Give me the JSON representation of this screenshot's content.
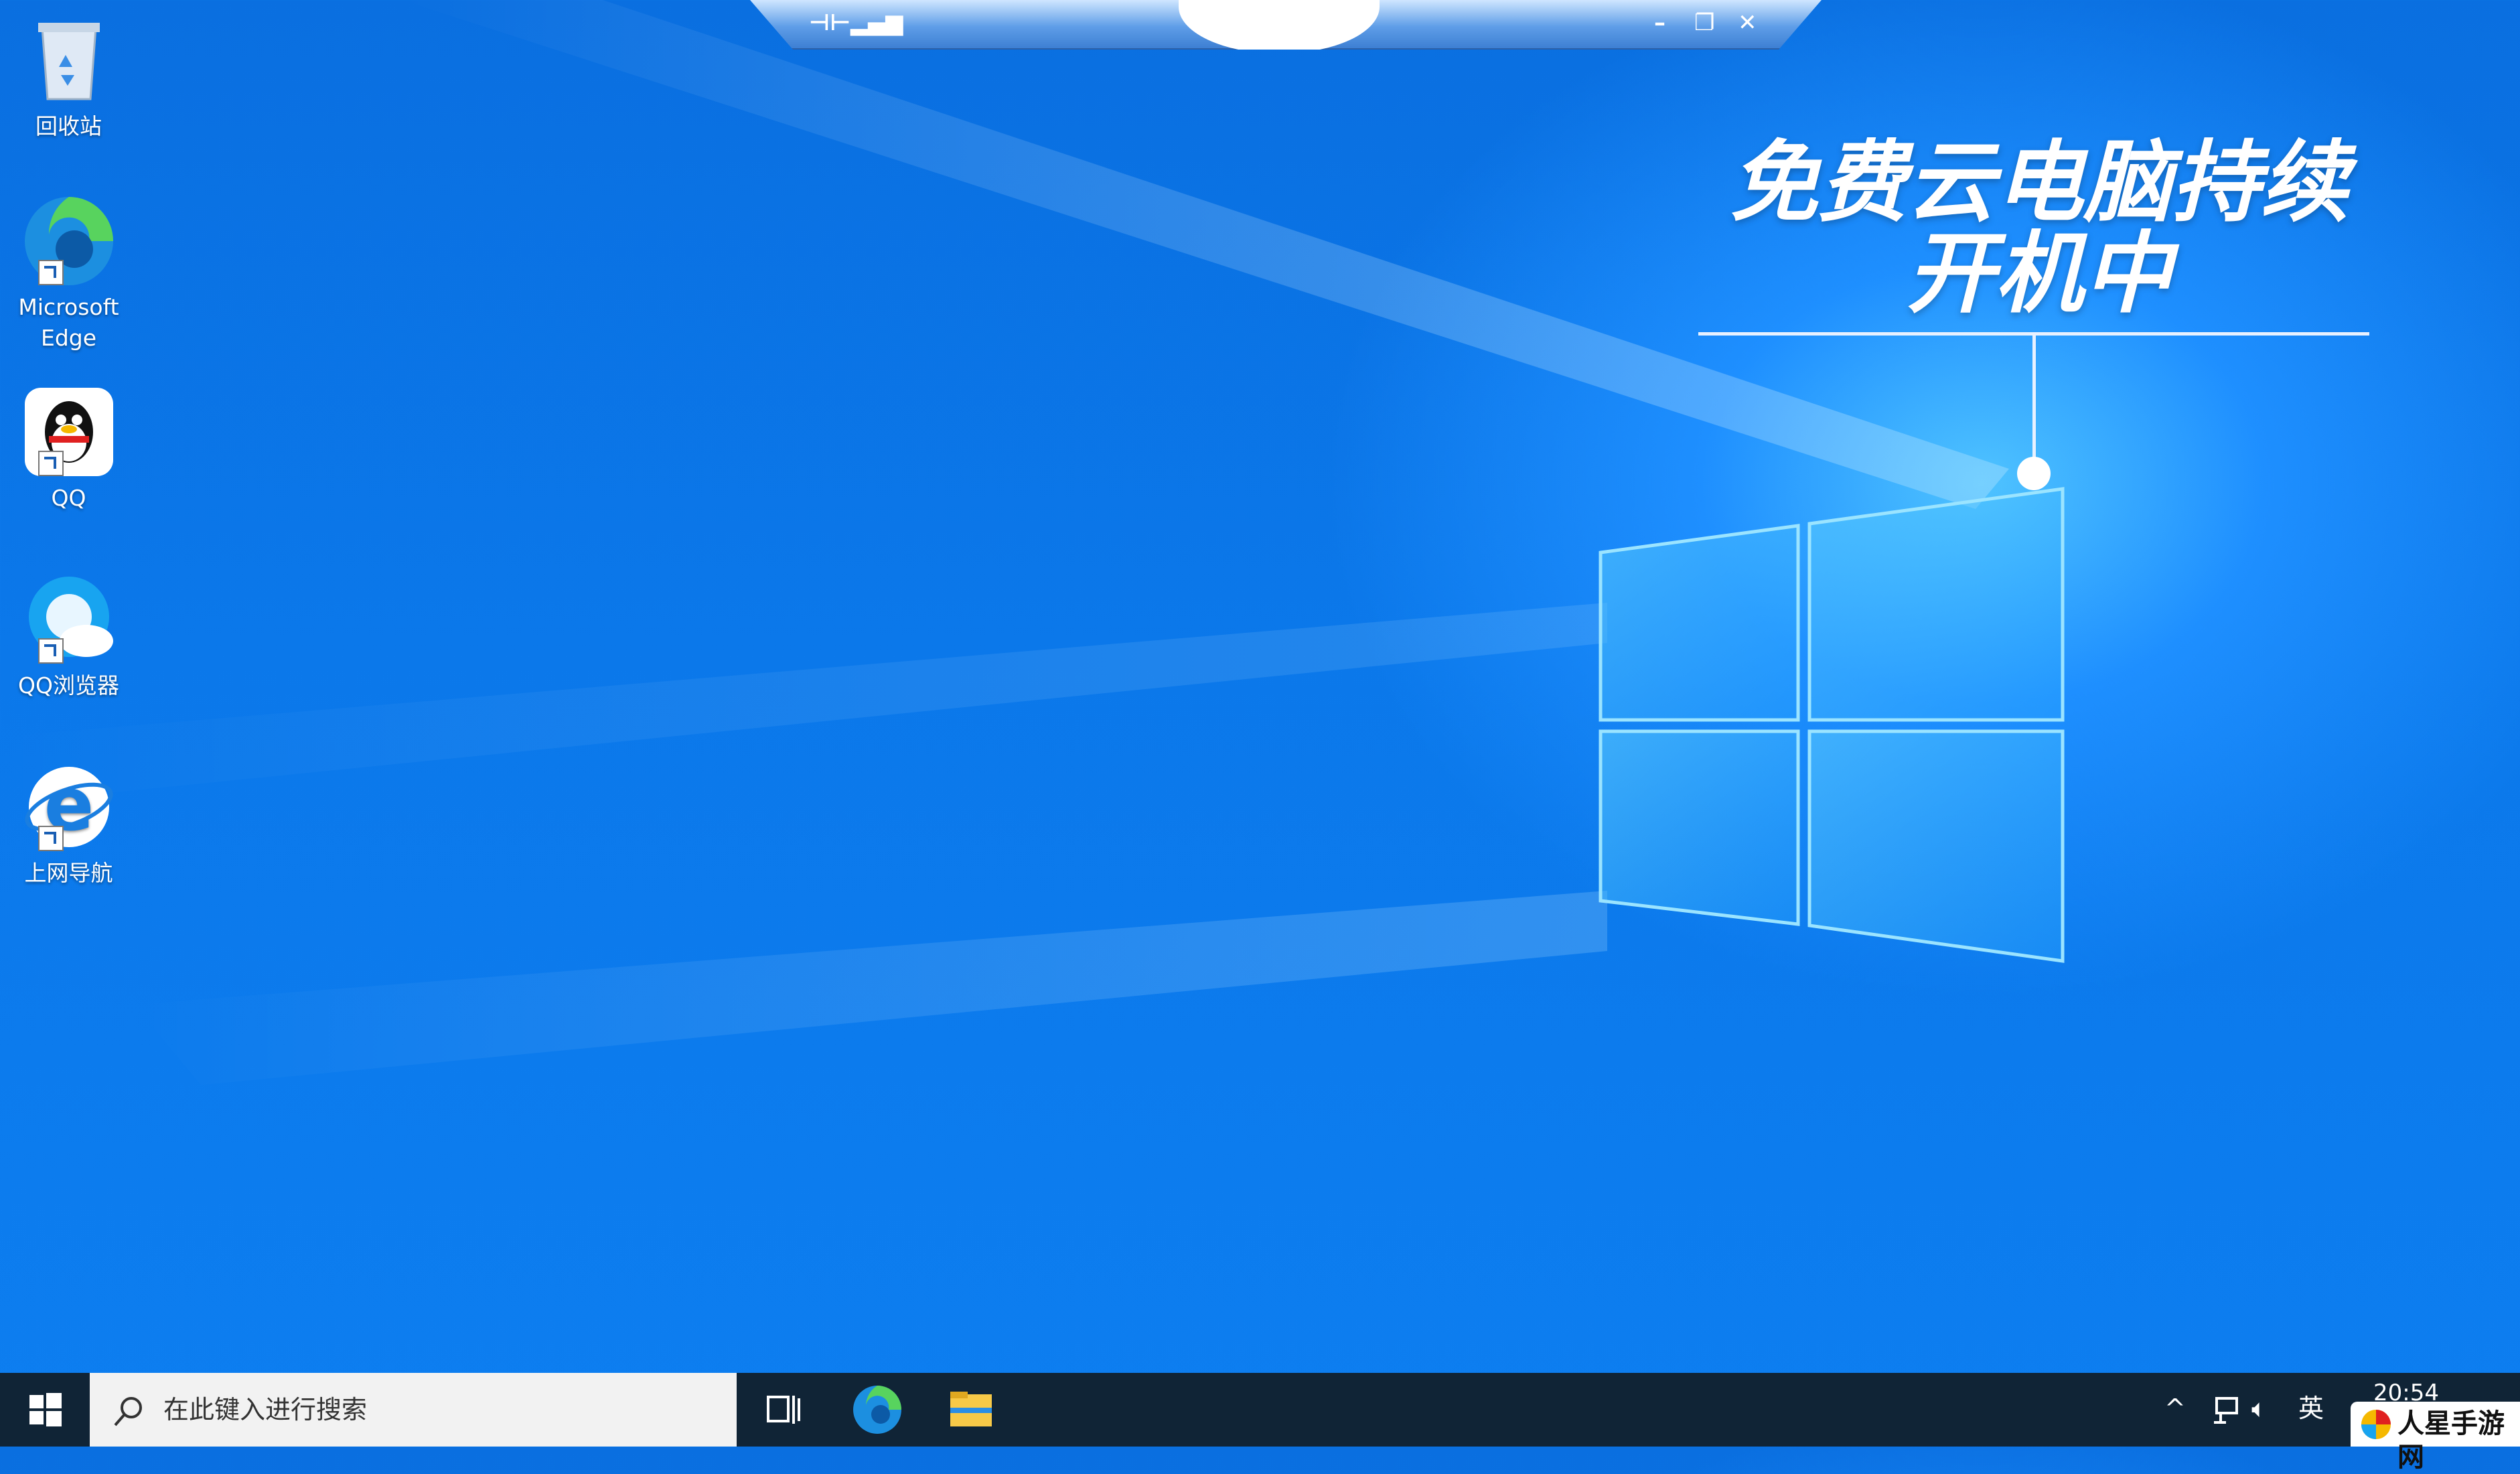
{
  "remote_bar": {
    "pin_icon": "pin-icon",
    "signal_icon": "signal-icon",
    "minimize_icon": "minimize-icon",
    "restore_icon": "restore-icon",
    "close_icon": "close-icon"
  },
  "desktop_icons": [
    {
      "label": "回收站",
      "icon": "recycle-bin-icon"
    },
    {
      "label_line1": "Microsoft",
      "label_line2": "Edge",
      "icon": "edge-icon"
    },
    {
      "label": "QQ",
      "icon": "qq-penguin-icon"
    },
    {
      "label": "QQ浏览器",
      "icon": "qq-browser-icon"
    },
    {
      "label": "上网导航",
      "icon": "ie-navigation-icon"
    }
  ],
  "overlay": {
    "line1": "免费云电脑持续",
    "line2": "开机中"
  },
  "taskbar": {
    "search_placeholder": "在此键入进行搜索",
    "time": "20:54",
    "ime": "英"
  },
  "watermark": {
    "text": "人星手游网"
  },
  "colors": {
    "desktop_blue": "#0b78ea",
    "glow": "#4fc3ff",
    "taskbar": "#102436"
  }
}
